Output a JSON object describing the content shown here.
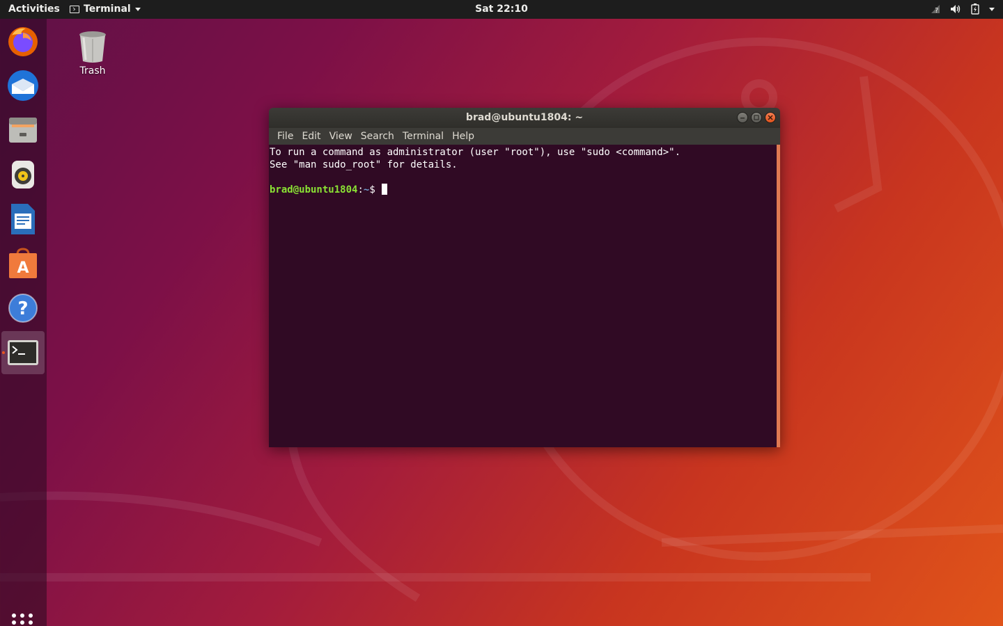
{
  "topbar": {
    "activities": "Activities",
    "app_name": "Terminal",
    "clock": "Sat 22:10"
  },
  "tray": {
    "icons": [
      "network-icon",
      "volume-icon",
      "battery-icon",
      "system-menu-caret"
    ]
  },
  "dock": {
    "items": [
      {
        "name": "Firefox",
        "icon": "firefox-icon"
      },
      {
        "name": "Thunderbird",
        "icon": "thunderbird-icon"
      },
      {
        "name": "Files",
        "icon": "files-icon"
      },
      {
        "name": "Rhythmbox",
        "icon": "rhythmbox-icon"
      },
      {
        "name": "LibreOffice Writer",
        "icon": "writer-icon"
      },
      {
        "name": "Ubuntu Software",
        "icon": "software-icon"
      },
      {
        "name": "Help",
        "icon": "help-icon"
      },
      {
        "name": "Terminal",
        "icon": "terminal-icon",
        "active": true
      }
    ],
    "show_apps_icon": "apps-grid-icon"
  },
  "desktop": {
    "trash_label": "Trash"
  },
  "window": {
    "title": "brad@ubuntu1804: ~",
    "menu": [
      "File",
      "Edit",
      "View",
      "Search",
      "Terminal",
      "Help"
    ],
    "lines": [
      "To run a command as administrator (user \"root\"), use \"sudo <command>\".",
      "See \"man sudo_root\" for details."
    ],
    "prompt_user": "brad@ubuntu1804",
    "prompt_sep": ":",
    "prompt_dir": "~",
    "prompt_symbol": "$ "
  },
  "colors": {
    "terminal_bg": "#300a24",
    "prompt_user": "#8ae234",
    "prompt_dir": "#729fcf",
    "accent": "#e95420"
  }
}
